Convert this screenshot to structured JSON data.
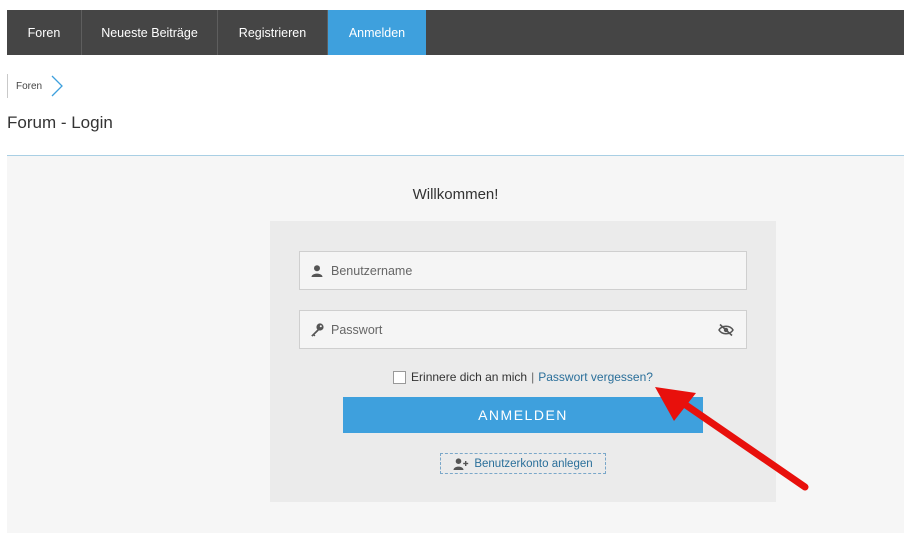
{
  "nav": {
    "tabs": [
      {
        "label": "Foren"
      },
      {
        "label": "Neueste Beiträge"
      },
      {
        "label": "Registrieren"
      },
      {
        "label": "Anmelden",
        "active": true
      }
    ]
  },
  "breadcrumb": {
    "item": "Foren"
  },
  "page": {
    "title": "Forum - Login"
  },
  "login": {
    "welcome": "Willkommen!",
    "username_placeholder": "Benutzername",
    "password_placeholder": "Passwort",
    "remember_label": "Erinnere dich an mich",
    "separator": "|",
    "forgot_label": "Passwort vergessen?",
    "submit_label": "ANMELDEN",
    "register_label": "Benutzerkonto anlegen"
  },
  "colors": {
    "nav_bg": "#454545",
    "accent": "#3ea0dd",
    "link": "#2a6f9a",
    "annotation_arrow": "#e8100c"
  },
  "icons": {
    "username": "user-icon",
    "password": "key-icon",
    "toggle_visibility": "eye-slash-icon",
    "register": "user-plus-icon",
    "breadcrumb_separator": "chevron-right-icon"
  }
}
